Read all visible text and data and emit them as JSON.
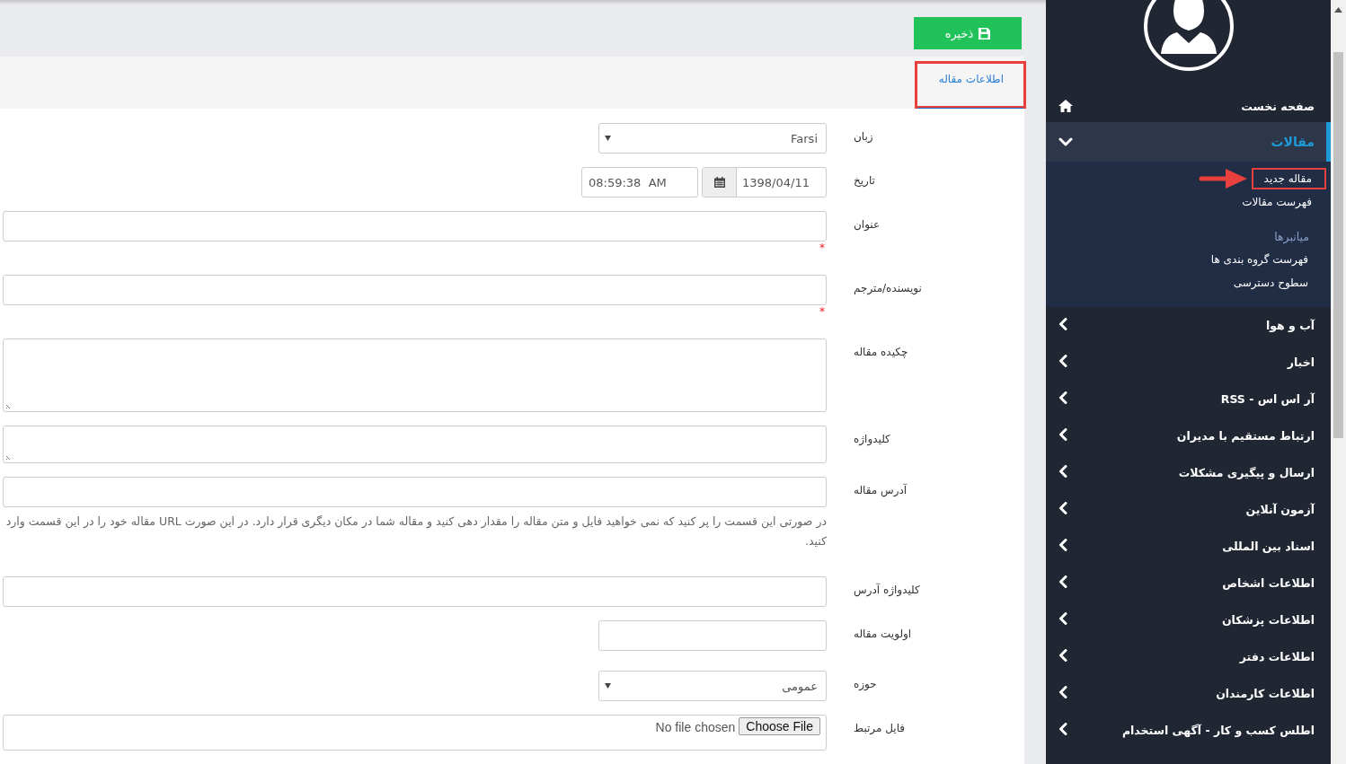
{
  "save_button": {
    "label": "ذخیره"
  },
  "tabs": [
    {
      "label": "اطلاعات مقاله",
      "selected": true,
      "annotated": true
    }
  ],
  "form": {
    "fields": [
      {
        "kind": "select",
        "label": "زبان",
        "value": "Farsi"
      },
      {
        "kind": "datetime",
        "label": "تاریخ",
        "date": "1398/04/11",
        "time": "08:59:38  AM"
      },
      {
        "kind": "text",
        "label": "عنوان",
        "required_mark": "*"
      },
      {
        "kind": "text",
        "label": "نویسنده/مترجم",
        "required_mark": "*"
      },
      {
        "kind": "textarea",
        "label": "چکیده مقاله"
      },
      {
        "kind": "small_textarea",
        "label": "کلیدواژه"
      },
      {
        "kind": "text",
        "label": "آدرس مقاله",
        "help": "در صورتی این قسمت را پر کنید که نمی خواهید فایل و متن مقاله را مقدار دهی کنید و مقاله شما در مکان دیگری قرار دارد. در این صورت URL مقاله خود را در این قسمت وارد کنید."
      },
      {
        "kind": "text",
        "label": "کلیدواژه آدرس"
      },
      {
        "kind": "short_text",
        "label": "اولویت مقاله"
      },
      {
        "kind": "select",
        "label": "حوزه",
        "value": "عمومی"
      },
      {
        "kind": "file",
        "label": "فایل مرتبط",
        "button": "Choose File",
        "status": "No file chosen"
      }
    ]
  },
  "sidebar": {
    "home": {
      "label": "صفحه نخست"
    },
    "menu": [
      {
        "label": "مقالات",
        "selected": true,
        "expanded": true,
        "children": [
          {
            "kind": "link",
            "label": "مقاله جدید",
            "annotated": true
          },
          {
            "kind": "link",
            "label": "فهرست مقالات",
            "annotated": false
          },
          {
            "kind": "heading",
            "label": "میانبرها"
          },
          {
            "kind": "link",
            "label": "فهرست گروه بندی ها",
            "annotated": false
          },
          {
            "kind": "link",
            "label": "سطوح دسترسی",
            "annotated": false
          }
        ]
      },
      {
        "label": "آب و هوا",
        "selected": false,
        "expanded": false
      },
      {
        "label": "اخبار",
        "selected": false,
        "expanded": false
      },
      {
        "label": "آر اس اس - RSS",
        "selected": false,
        "expanded": false
      },
      {
        "label": "ارتباط مستقیم با مدیران",
        "selected": false,
        "expanded": false
      },
      {
        "label": "ارسال و پیگیری مشکلات",
        "selected": false,
        "expanded": false
      },
      {
        "label": "آزمون آنلاین",
        "selected": false,
        "expanded": false
      },
      {
        "label": "اسناد بین المللی",
        "selected": false,
        "expanded": false
      },
      {
        "label": "اطلاعات اشخاص",
        "selected": false,
        "expanded": false
      },
      {
        "label": "اطلاعات پزشکان",
        "selected": false,
        "expanded": false
      },
      {
        "label": "اطلاعات دفتر",
        "selected": false,
        "expanded": false
      },
      {
        "label": "اطلاعات کارمندان",
        "selected": false,
        "expanded": false
      },
      {
        "label": "اطلس کسب و کار - آگهی استخدام",
        "selected": false,
        "expanded": false
      }
    ]
  }
}
